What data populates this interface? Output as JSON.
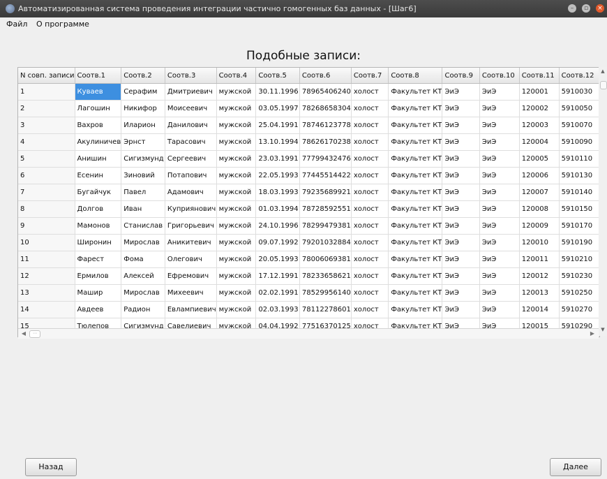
{
  "window": {
    "title": "Автоматизированная система проведения интеграции частично гомогенных баз данных - [Шаг6]",
    "colors": {
      "titlebar": "#3f3f3f",
      "close": "#e25a2c",
      "selection": "#3d8fe0"
    }
  },
  "menu": {
    "items": [
      "Файл",
      "О программе"
    ]
  },
  "heading": "Подобные записи:",
  "table": {
    "columns": [
      "N совп. записи",
      "Соотв.1",
      "Соотв.2",
      "Соотв.3",
      "Соотв.4",
      "Соотв.5",
      "Соотв.6",
      "Соотв.7",
      "Соотв.8",
      "Соотв.9",
      "Соотв.10",
      "Соотв.11",
      "Соотв.12"
    ],
    "selected_cell": {
      "row": 0,
      "col": 1
    },
    "rows": [
      [
        "1",
        "Куваев",
        "Серафим",
        "Дмитриевич",
        "мужской",
        "30.11.1996",
        "78965406240",
        "холост",
        "Факультет КТ",
        "ЭиЭ",
        "ЭиЭ",
        "120001",
        "5910030"
      ],
      [
        "2",
        "Лагошин",
        "Никифор",
        "Моисеевич",
        "мужской",
        "03.05.1997",
        "78268658304",
        "холост",
        "Факультет КТ",
        "ЭиЭ",
        "ЭиЭ",
        "120002",
        "5910050"
      ],
      [
        "3",
        "Вахров",
        "Иларион",
        "Данилович",
        "мужской",
        "25.04.1991",
        "78746123778",
        "холост",
        "Факультет КТ",
        "ЭиЭ",
        "ЭиЭ",
        "120003",
        "5910070"
      ],
      [
        "4",
        "Акулиничев",
        "Эрнст",
        "Тарасович",
        "мужской",
        "13.10.1994",
        "78626170238",
        "холост",
        "Факультет КТ",
        "ЭиЭ",
        "ЭиЭ",
        "120004",
        "5910090"
      ],
      [
        "5",
        "Анишин",
        "Сигизмунд",
        "Сергеевич",
        "мужской",
        "23.03.1991",
        "77799432476",
        "холост",
        "Факультет КТ",
        "ЭиЭ",
        "ЭиЭ",
        "120005",
        "5910110"
      ],
      [
        "6",
        "Есенин",
        "Зиновий",
        "Потапович",
        "мужской",
        "22.05.1993",
        "77445514422",
        "холост",
        "Факультет КТ",
        "ЭиЭ",
        "ЭиЭ",
        "120006",
        "5910130"
      ],
      [
        "7",
        "Бугайчук",
        "Павел",
        "Адамович",
        "мужской",
        "18.03.1993",
        "79235689921",
        "холост",
        "Факультет КТ",
        "ЭиЭ",
        "ЭиЭ",
        "120007",
        "5910140"
      ],
      [
        "8",
        "Долгов",
        "Иван",
        "Куприянович",
        "мужской",
        "01.03.1994",
        "78728592551",
        "холост",
        "Факультет КТ",
        "ЭиЭ",
        "ЭиЭ",
        "120008",
        "5910150"
      ],
      [
        "9",
        "Мамонов",
        "Станислав",
        "Григорьевич",
        "мужской",
        "24.10.1996",
        "78299479381",
        "холост",
        "Факультет КТ",
        "ЭиЭ",
        "ЭиЭ",
        "120009",
        "5910170"
      ],
      [
        "10",
        "Широнин",
        "Мирослав",
        "Аникитевич",
        "мужской",
        "09.07.1992",
        "79201032884",
        "холост",
        "Факультет КТ",
        "ЭиЭ",
        "ЭиЭ",
        "120010",
        "5910190"
      ],
      [
        "11",
        "Фарест",
        "Фома",
        "Олегович",
        "мужской",
        "20.05.1993",
        "78006069381",
        "холост",
        "Факультет КТ",
        "ЭиЭ",
        "ЭиЭ",
        "120011",
        "5910210"
      ],
      [
        "12",
        "Ермилов",
        "Алексей",
        "Ефремович",
        "мужской",
        "17.12.1991",
        "78233658621",
        "холост",
        "Факультет КТ",
        "ЭиЭ",
        "ЭиЭ",
        "120012",
        "5910230"
      ],
      [
        "13",
        "Машир",
        "Мирослав",
        "Михеевич",
        "мужской",
        "02.02.1991",
        "78529956140",
        "холост",
        "Факультет КТ",
        "ЭиЭ",
        "ЭиЭ",
        "120013",
        "5910250"
      ],
      [
        "14",
        "Авдеев",
        "Радион",
        "Евлампиевич",
        "мужской",
        "02.03.1993",
        "78112278601",
        "холост",
        "Факультет КТ",
        "ЭиЭ",
        "ЭиЭ",
        "120014",
        "5910270"
      ],
      [
        "15",
        "Тюлепов",
        "Сигизмунд",
        "Савелиевич",
        "мужской",
        "04.04.1992",
        "77516370125",
        "холост",
        "Факультет КТ",
        "ЭиЭ",
        "ЭиЭ",
        "120015",
        "5910290"
      ]
    ]
  },
  "hscroll": {
    "thumb_glyph": "⋯"
  },
  "buttons": {
    "back": "Назад",
    "next": "Далее"
  }
}
